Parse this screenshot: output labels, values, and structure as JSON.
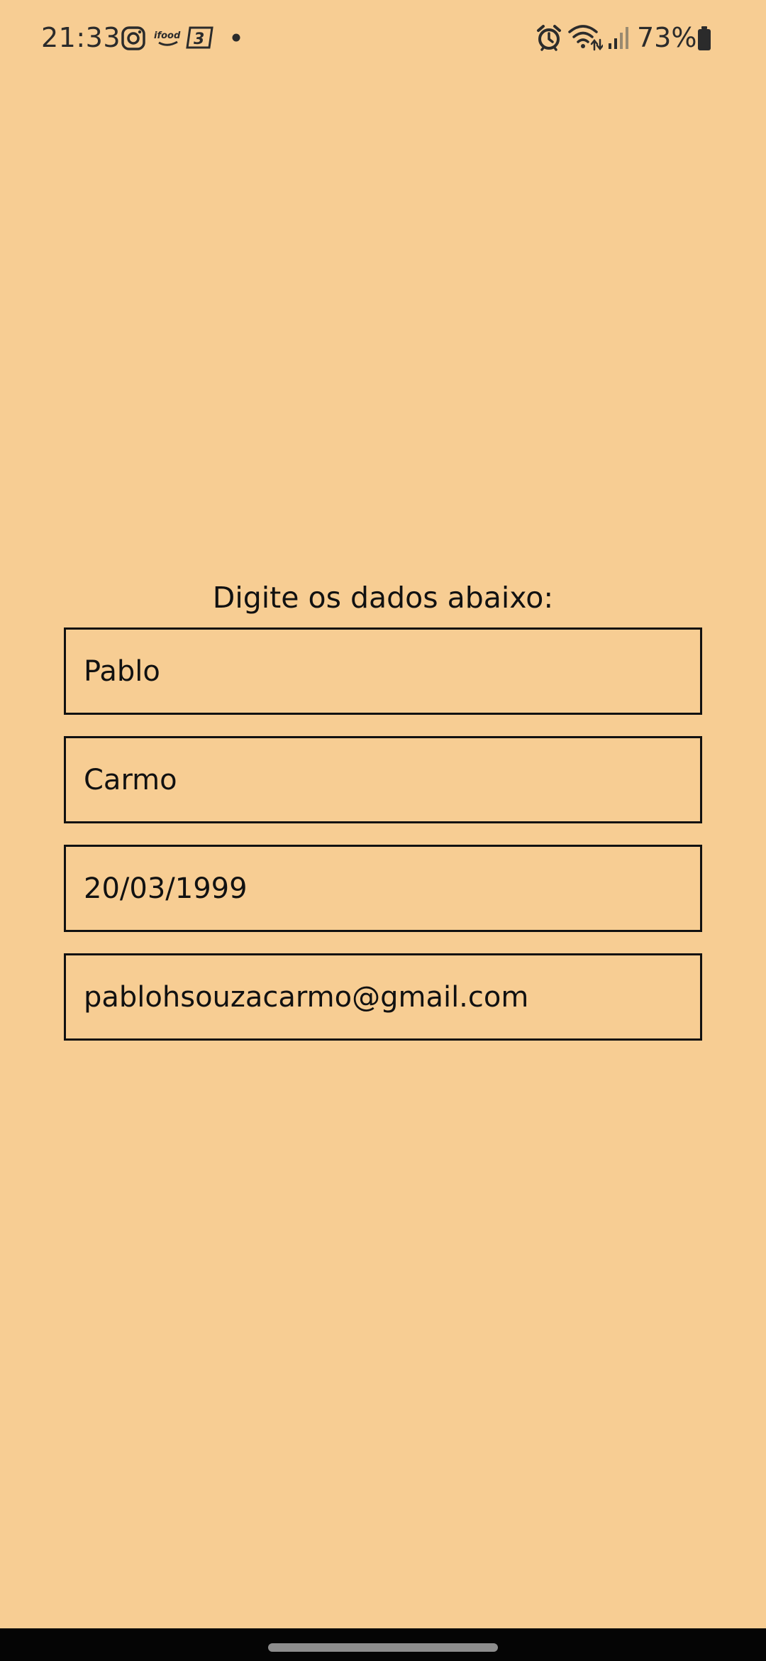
{
  "status_bar": {
    "time": "21:33",
    "battery_percent": "73%",
    "notification_icons": [
      "instagram-icon",
      "ifood-icon",
      "app-3-icon",
      "dot-icon"
    ],
    "system_icons": [
      "alarm-icon",
      "wifi-icon",
      "signal-icon",
      "battery-icon"
    ],
    "app_icon_labels": {
      "ifood": "ifood",
      "app3": "3"
    }
  },
  "form": {
    "title": "Digite os dados abaixo:",
    "fields": [
      {
        "name": "first-name",
        "value": "Pablo"
      },
      {
        "name": "last-name",
        "value": "Carmo"
      },
      {
        "name": "birth-date",
        "value": "20/03/1999"
      },
      {
        "name": "email",
        "value": "pablohsouzacarmo@gmail.com"
      }
    ]
  },
  "colors": {
    "background": "#F7CD93",
    "text": "#111111",
    "border": "#111111",
    "nav_bar": "#050505",
    "nav_handle": "#8D8D8D"
  }
}
